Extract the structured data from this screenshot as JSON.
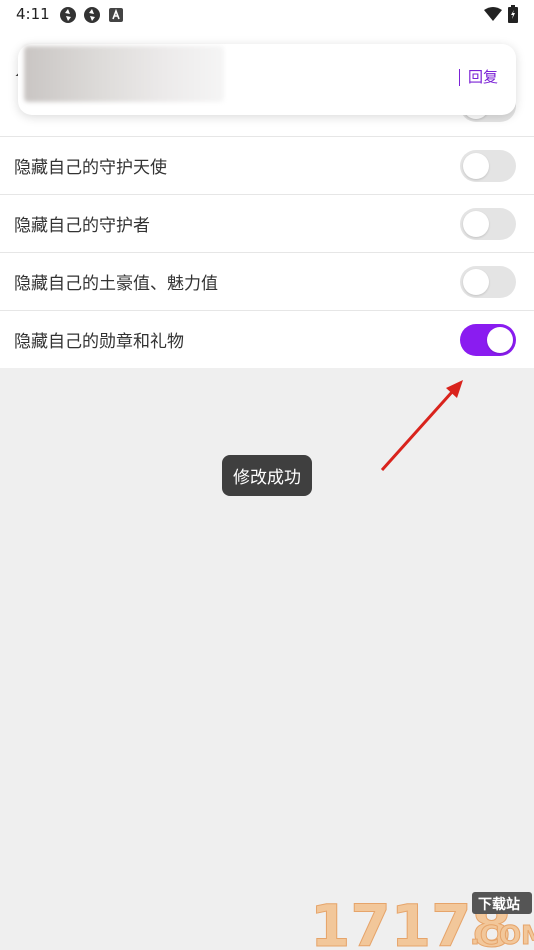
{
  "status_bar": {
    "time": "4:11"
  },
  "notification": {
    "reply_label": "回复"
  },
  "settings": {
    "items": [
      {
        "label": "",
        "on": false
      },
      {
        "label": "隐藏自己的守护天使",
        "on": false
      },
      {
        "label": "隐藏自己的守护者",
        "on": false
      },
      {
        "label": "隐藏自己的土豪值、魅力值",
        "on": false
      },
      {
        "label": "隐藏自己的勋章和礼物",
        "on": true
      }
    ]
  },
  "toast": {
    "text": "修改成功"
  },
  "watermark": {
    "logo_text": "17178 下载站 .COM"
  },
  "colors": {
    "accent": "#8a1cf0",
    "toggle_off": "#e4e4e4",
    "background": "#efefef",
    "toast_bg": "#3f3f3f",
    "annotation_arrow": "#d9231c"
  }
}
